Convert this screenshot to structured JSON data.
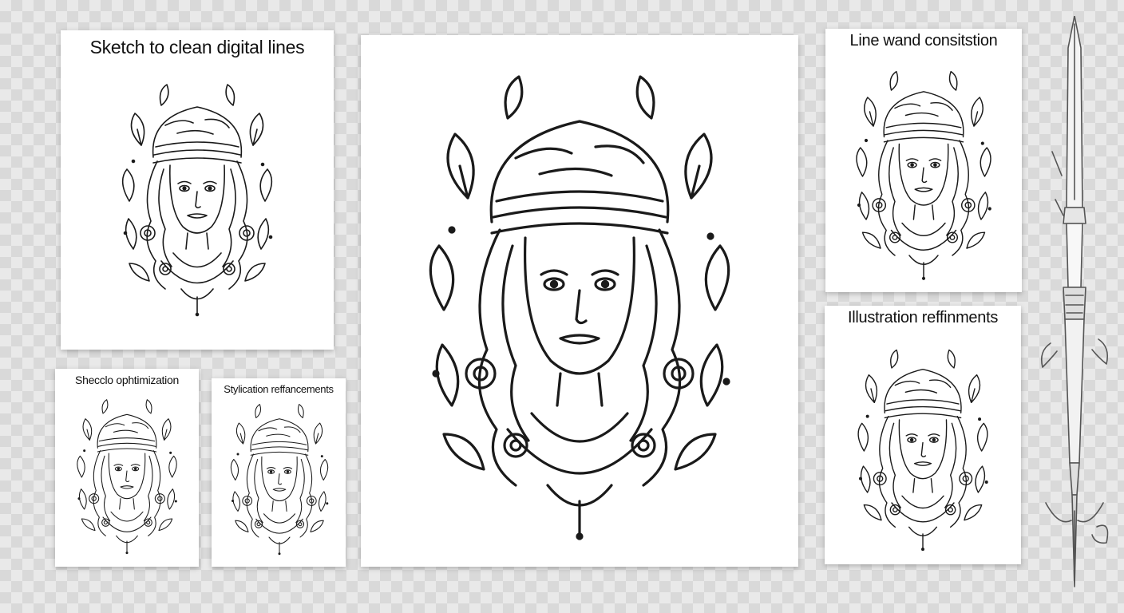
{
  "panels": {
    "sketch_to_clean": {
      "title": "Sketch to clean digital lines"
    },
    "sketch_optimization": {
      "title": "Shecclo ophtimization"
    },
    "stylization": {
      "title": "Stylication reffancements"
    },
    "main_artwork": {
      "title": ""
    },
    "line_consistency": {
      "title": "Line wand consitstion"
    },
    "illustration_refinements": {
      "title": "Illustration reffinments"
    }
  },
  "icons": {
    "illustration": "woman-portrait-line-art-icon",
    "pen": "fountain-pen-icon"
  },
  "colors": {
    "background": "#e9e9e9",
    "checker": "#d9d9d9",
    "card": "#ffffff",
    "ink": "#111111"
  }
}
